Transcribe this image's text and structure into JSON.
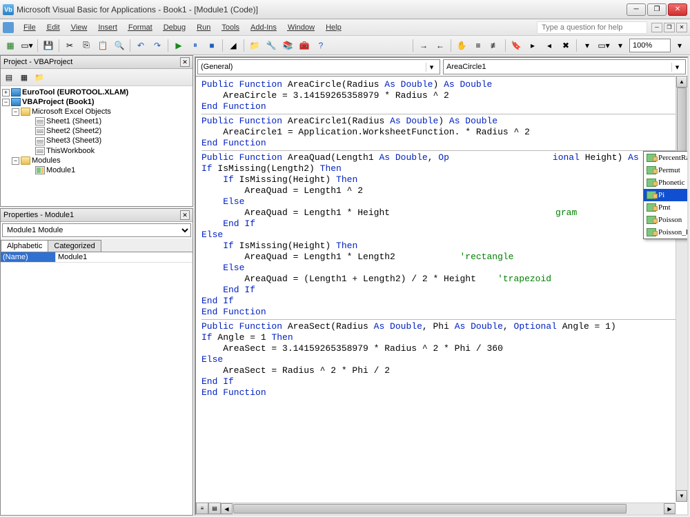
{
  "title": "Microsoft Visual Basic for Applications - Book1 - [Module1 (Code)]",
  "menus": [
    "File",
    "Edit",
    "View",
    "Insert",
    "Format",
    "Debug",
    "Run",
    "Tools",
    "Add-Ins",
    "Window",
    "Help"
  ],
  "search_placeholder": "Type a question for help",
  "zoom": "100%",
  "project": {
    "title": "Project - VBAProject",
    "nodes": {
      "eurotool": "EuroTool (EUROTOOL.XLAM)",
      "vbaproject": "VBAProject (Book1)",
      "msexcel": "Microsoft Excel Objects",
      "sheet1": "Sheet1 (Sheet1)",
      "sheet2": "Sheet2 (Sheet2)",
      "sheet3": "Sheet3 (Sheet3)",
      "thiswb": "ThisWorkbook",
      "modules": "Modules",
      "module1": "Module1"
    }
  },
  "properties": {
    "title": "Properties - Module1",
    "combo": "Module1 Module",
    "tabs": {
      "alpha": "Alphabetic",
      "cat": "Categorized"
    },
    "name_key": "(Name)",
    "name_val": "Module1"
  },
  "codedrops": {
    "left": "(General)",
    "right": "AreaCircle1"
  },
  "code": {
    "l1a": "Public Function",
    "l1b": " AreaCircle(Radius ",
    "l1c": "As Double",
    "l1d": ") ",
    "l1e": "As Double",
    "l2": "    AreaCircle = 3.14159265358979 * Radius ^ 2",
    "l3": "End Function",
    "l5a": "Public Function",
    "l5b": " AreaCircle1(Radius ",
    "l5c": "As Double",
    "l5d": ") ",
    "l5e": "As Double",
    "l6a": "    AreaCircle1 = Application.WorksheetFunction.",
    "l6b": " * Radius ^ 2",
    "l7": "End Function",
    "l9a": "Public Function",
    "l9b": " AreaQuad(Length1 ",
    "l9c": "As Double",
    "l9d": ", ",
    "l9e": "Op",
    "l9f": "ional",
    "l9g": " Height) ",
    "l9h": "As Double",
    "l10a": "If",
    "l10b": " IsMissing(Length2) ",
    "l10c": "Then",
    "l11a": "    If",
    "l11b": " IsMissing(Height) ",
    "l11c": "Then",
    "l12": "        AreaQuad = Length1 ^ 2",
    "l13": "    Else",
    "l14a": "        AreaQuad = Length1 * Height",
    "l14cm": "gram",
    "l15": "    End If",
    "l16": "Else",
    "l17a": "    If",
    "l17b": " IsMissing(Height) ",
    "l17c": "Then",
    "l18a": "        AreaQuad = Length1 * Length2            ",
    "l18cm": "'rectangle",
    "l19": "    Else",
    "l20a": "        AreaQuad = (Length1 + Length2) / 2 * Height    ",
    "l20cm": "'trapezoid",
    "l21": "    End If",
    "l22": "End If",
    "l23": "End Function",
    "l25a": "Public Function",
    "l25b": " AreaSect(Radius ",
    "l25c": "As Double",
    "l25d": ", Phi ",
    "l25e": "As Double",
    "l25f": ", ",
    "l25g": "Optional",
    "l25h": " Angle = 1)",
    "l26a": "If",
    "l26b": " Angle = 1 ",
    "l26c": "Then",
    "l27": "    AreaSect = 3.14159265358979 * Radius ^ 2 * Phi / 360",
    "l28": "Else",
    "l29": "    AreaSect = Radius ^ 2 * Phi / 2",
    "l30": "End If",
    "l31": "End Function"
  },
  "autocomplete": {
    "items": [
      "PercentRank_Inc",
      "Permut",
      "Phonetic",
      "Pi",
      "Pmt",
      "Poisson",
      "Poisson_Dist"
    ],
    "selected": "Pi"
  }
}
